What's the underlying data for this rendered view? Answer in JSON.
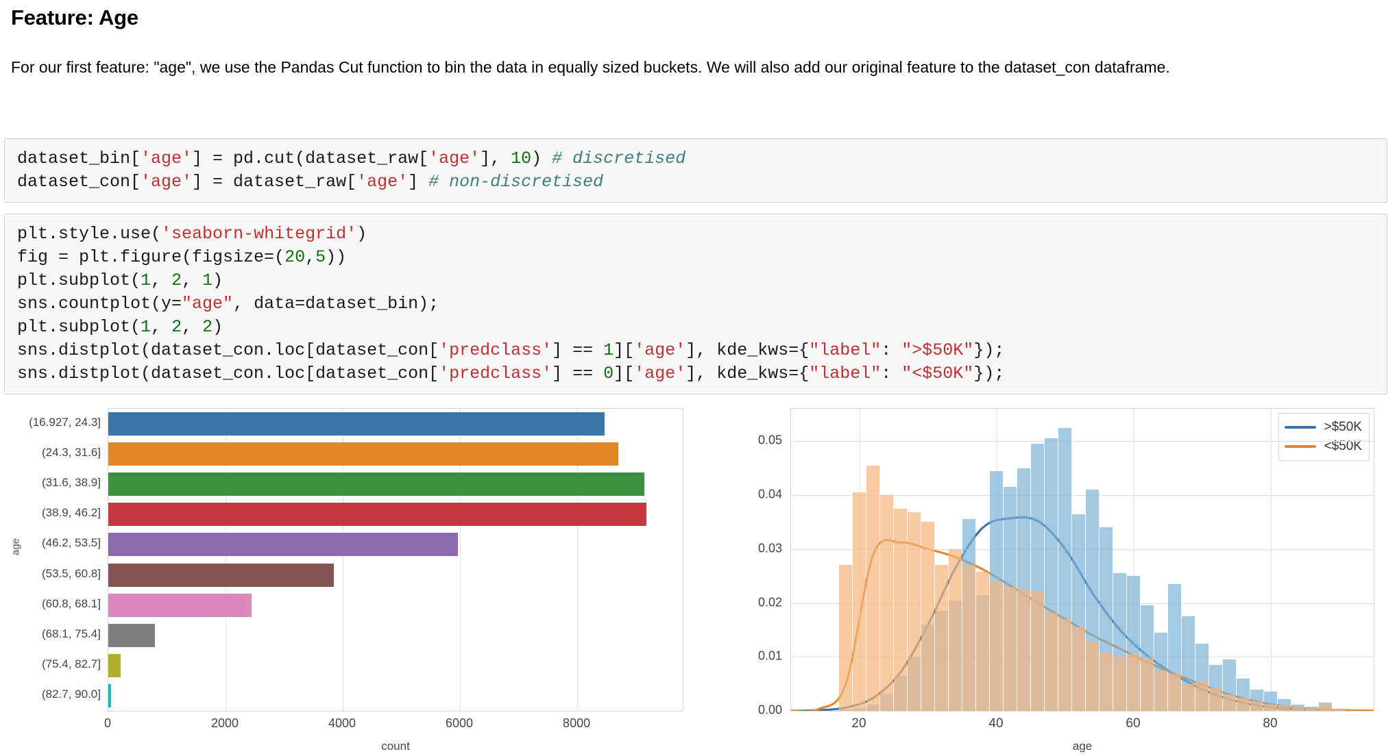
{
  "heading": "Feature: Age",
  "paragraph": "For our first feature: \"age\", we use the Pandas Cut function to bin the data in equally sized buckets. We will also add our original feature to the dataset_con dataframe.",
  "code_cells": [
    {
      "name": "binning-code-cell",
      "lines": [
        "dataset_bin['age'] = pd.cut(dataset_raw['age'], 10) # discretised",
        "dataset_con['age'] = dataset_raw['age'] # non-discretised"
      ]
    },
    {
      "name": "plotting-code-cell",
      "lines": [
        "plt.style.use('seaborn-whitegrid')",
        "fig = plt.figure(figsize=(20,5))",
        "plt.subplot(1, 2, 1)",
        "sns.countplot(y=\"age\", data=dataset_bin);",
        "plt.subplot(1, 2, 2)",
        "sns.distplot(dataset_con.loc[dataset_con['predclass'] == 1]['age'], kde_kws={\"label\": \">$50K\"});",
        "sns.distplot(dataset_con.loc[dataset_con['predclass'] == 0]['age'], kde_kws={\"label\": \"<$50K\"});"
      ]
    }
  ],
  "chart_data": [
    {
      "name": "age-bin-countplot",
      "type": "bar",
      "orientation": "horizontal",
      "title": "",
      "xlabel": "count",
      "ylabel": "age",
      "xlim": [
        0,
        9800
      ],
      "xticks": [
        0,
        2000,
        4000,
        6000,
        8000
      ],
      "grid": true,
      "categories": [
        "(16.927, 24.3]",
        "(24.3, 31.6]",
        "(31.6, 38.9]",
        "(38.9, 46.2]",
        "(46.2, 53.5]",
        "(53.5, 60.8]",
        "(60.8, 68.1]",
        "(68.1, 75.4]",
        "(75.4, 82.7]",
        "(82.7, 90.0]"
      ],
      "values": [
        8470,
        8700,
        9140,
        9180,
        5970,
        3850,
        2440,
        790,
        215,
        40
      ],
      "colors": [
        "#3b75a8",
        "#e2862c",
        "#3c9141",
        "#c4393f",
        "#8d6ab0",
        "#845550",
        "#dd87bf",
        "#7f7f7f",
        "#b0ad2f",
        "#1fb5c4"
      ]
    },
    {
      "name": "age-distribution-distplot",
      "type": "histogram",
      "title": "",
      "xlabel": "age",
      "ylabel": "",
      "xlim": [
        10,
        95
      ],
      "ylim": [
        0.0,
        0.056
      ],
      "xticks": [
        20,
        40,
        60,
        80
      ],
      "yticks": [
        "0.00",
        "0.01",
        "0.02",
        "0.03",
        "0.04",
        "0.05"
      ],
      "grid": true,
      "legend_position": "upper right",
      "series": [
        {
          "name": ">$50K",
          "color": "#3b75a8",
          "hist_color": "#7ab0d6",
          "bin_starts": [
            17,
            19,
            21,
            23,
            25,
            27,
            29,
            31,
            33,
            35,
            37,
            39,
            41,
            43,
            45,
            47,
            49,
            51,
            53,
            55,
            57,
            59,
            61,
            63,
            65,
            67,
            69,
            71,
            73,
            75,
            77,
            79,
            81,
            83,
            85,
            87,
            89
          ],
          "bin_width": 2,
          "values": [
            0.0002,
            0.0005,
            0.0012,
            0.003,
            0.0065,
            0.01,
            0.016,
            0.0185,
            0.0205,
            0.0355,
            0.0215,
            0.0445,
            0.0415,
            0.045,
            0.0495,
            0.0505,
            0.0525,
            0.0365,
            0.041,
            0.034,
            0.0255,
            0.025,
            0.0195,
            0.0145,
            0.0235,
            0.0175,
            0.0125,
            0.0085,
            0.0095,
            0.006,
            0.004,
            0.0035,
            0.0022,
            0.0012,
            0.0008,
            0.0015,
            0.0004
          ],
          "kde_x": [
            10,
            14,
            18,
            22,
            26,
            30,
            34,
            38,
            42,
            46,
            50,
            54,
            58,
            62,
            66,
            70,
            74,
            78,
            82,
            86,
            90,
            95
          ],
          "kde_y": [
            0.0,
            0.0001,
            0.0006,
            0.0024,
            0.0072,
            0.016,
            0.0265,
            0.034,
            0.0357,
            0.0352,
            0.03,
            0.0218,
            0.015,
            0.0102,
            0.0067,
            0.004,
            0.0021,
            0.001,
            0.0004,
            0.0002,
            0.0001,
            0.0
          ]
        },
        {
          "name": "<$50K",
          "color": "#e2862c",
          "hist_color": "#f7b37a",
          "bin_starts": [
            17,
            19,
            21,
            23,
            25,
            27,
            29,
            31,
            33,
            35,
            37,
            39,
            41,
            43,
            45,
            47,
            49,
            51,
            53,
            55,
            57,
            59,
            61,
            63,
            65,
            67,
            69,
            71,
            73,
            75,
            77,
            79,
            81,
            83,
            85,
            87,
            89
          ],
          "bin_width": 2,
          "values": [
            0.027,
            0.0405,
            0.0455,
            0.04,
            0.0375,
            0.0368,
            0.035,
            0.027,
            0.03,
            0.027,
            0.0258,
            0.024,
            0.023,
            0.0225,
            0.0222,
            0.0182,
            0.017,
            0.0155,
            0.0128,
            0.0108,
            0.01,
            0.0105,
            0.0098,
            0.0075,
            0.0068,
            0.005,
            0.0055,
            0.0042,
            0.003,
            0.0024,
            0.0018,
            0.0012,
            0.001,
            0.0008,
            0.0005,
            0.0012,
            0.0004
          ],
          "kde_x": [
            10,
            14,
            18,
            22,
            26,
            30,
            34,
            38,
            42,
            46,
            50,
            54,
            58,
            62,
            66,
            70,
            74,
            78,
            82,
            86,
            90,
            95
          ],
          "kde_y": [
            0.0,
            0.0003,
            0.005,
            0.029,
            0.0312,
            0.03,
            0.0285,
            0.0262,
            0.0232,
            0.02,
            0.017,
            0.014,
            0.0115,
            0.009,
            0.0068,
            0.0048,
            0.003,
            0.0017,
            0.0008,
            0.0003,
            0.0001,
            0.0
          ]
        }
      ]
    }
  ]
}
